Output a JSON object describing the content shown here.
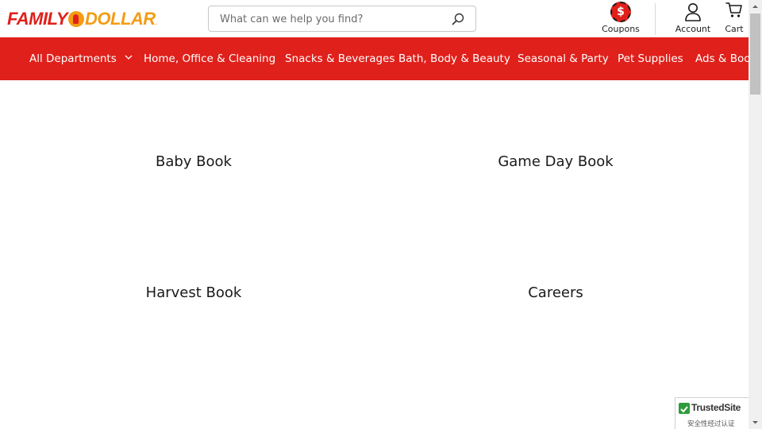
{
  "header": {
    "logo": {
      "word1": "FAMILY",
      "word2": "DOLLAR",
      "mark": "."
    },
    "search": {
      "placeholder": "What can we help you find?",
      "value": "",
      "icon": "search-icon"
    },
    "coupons": {
      "label": "Coupons",
      "badge": "$"
    },
    "account": {
      "label": "Account",
      "icon": "person-icon"
    },
    "cart": {
      "label": "Cart",
      "icon": "cart-icon"
    }
  },
  "nav": {
    "items": [
      {
        "label": "All Departments"
      },
      {
        "label": "Home, Office & Cleaning"
      },
      {
        "label": "Snacks & Beverages"
      },
      {
        "label": "Bath, Body & Beauty"
      },
      {
        "label": "Seasonal & Party"
      },
      {
        "label": "Pet Supplies"
      },
      {
        "label": "Ads & Books"
      }
    ]
  },
  "tiles": [
    {
      "label": "Baby Book"
    },
    {
      "label": "Game Day Book"
    },
    {
      "label": "Harvest Book"
    },
    {
      "label": "Careers"
    }
  ],
  "trusted_badge": {
    "name": "TrustedSite",
    "sub": "安全性经过认证"
  },
  "colors": {
    "brand_red": "#e0201b",
    "brand_orange": "#f39c12",
    "text": "#1a1a1a"
  }
}
